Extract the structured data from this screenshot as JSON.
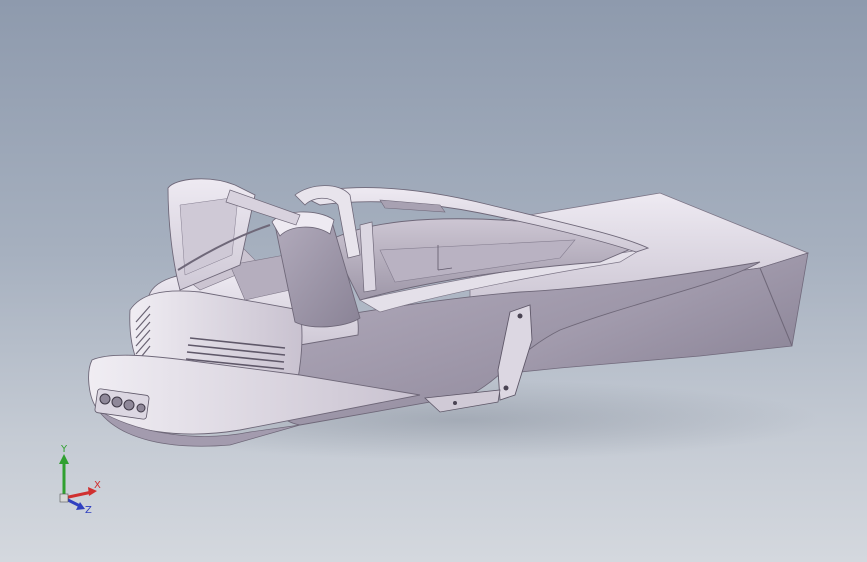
{
  "viewport": {
    "background_top": "#8e9aad",
    "background_bottom": "#d4d8de"
  },
  "model": {
    "icon": "car-chassis-3d-model",
    "shade_light": "#e6e2ea",
    "shade_mid": "#bdb6c6",
    "shade_dark": "#8f8899"
  },
  "triad": {
    "x_label": "X",
    "y_label": "Y",
    "z_label": "Z",
    "x_color": "#d03030",
    "y_color": "#30a030",
    "z_color": "#3040c0"
  }
}
